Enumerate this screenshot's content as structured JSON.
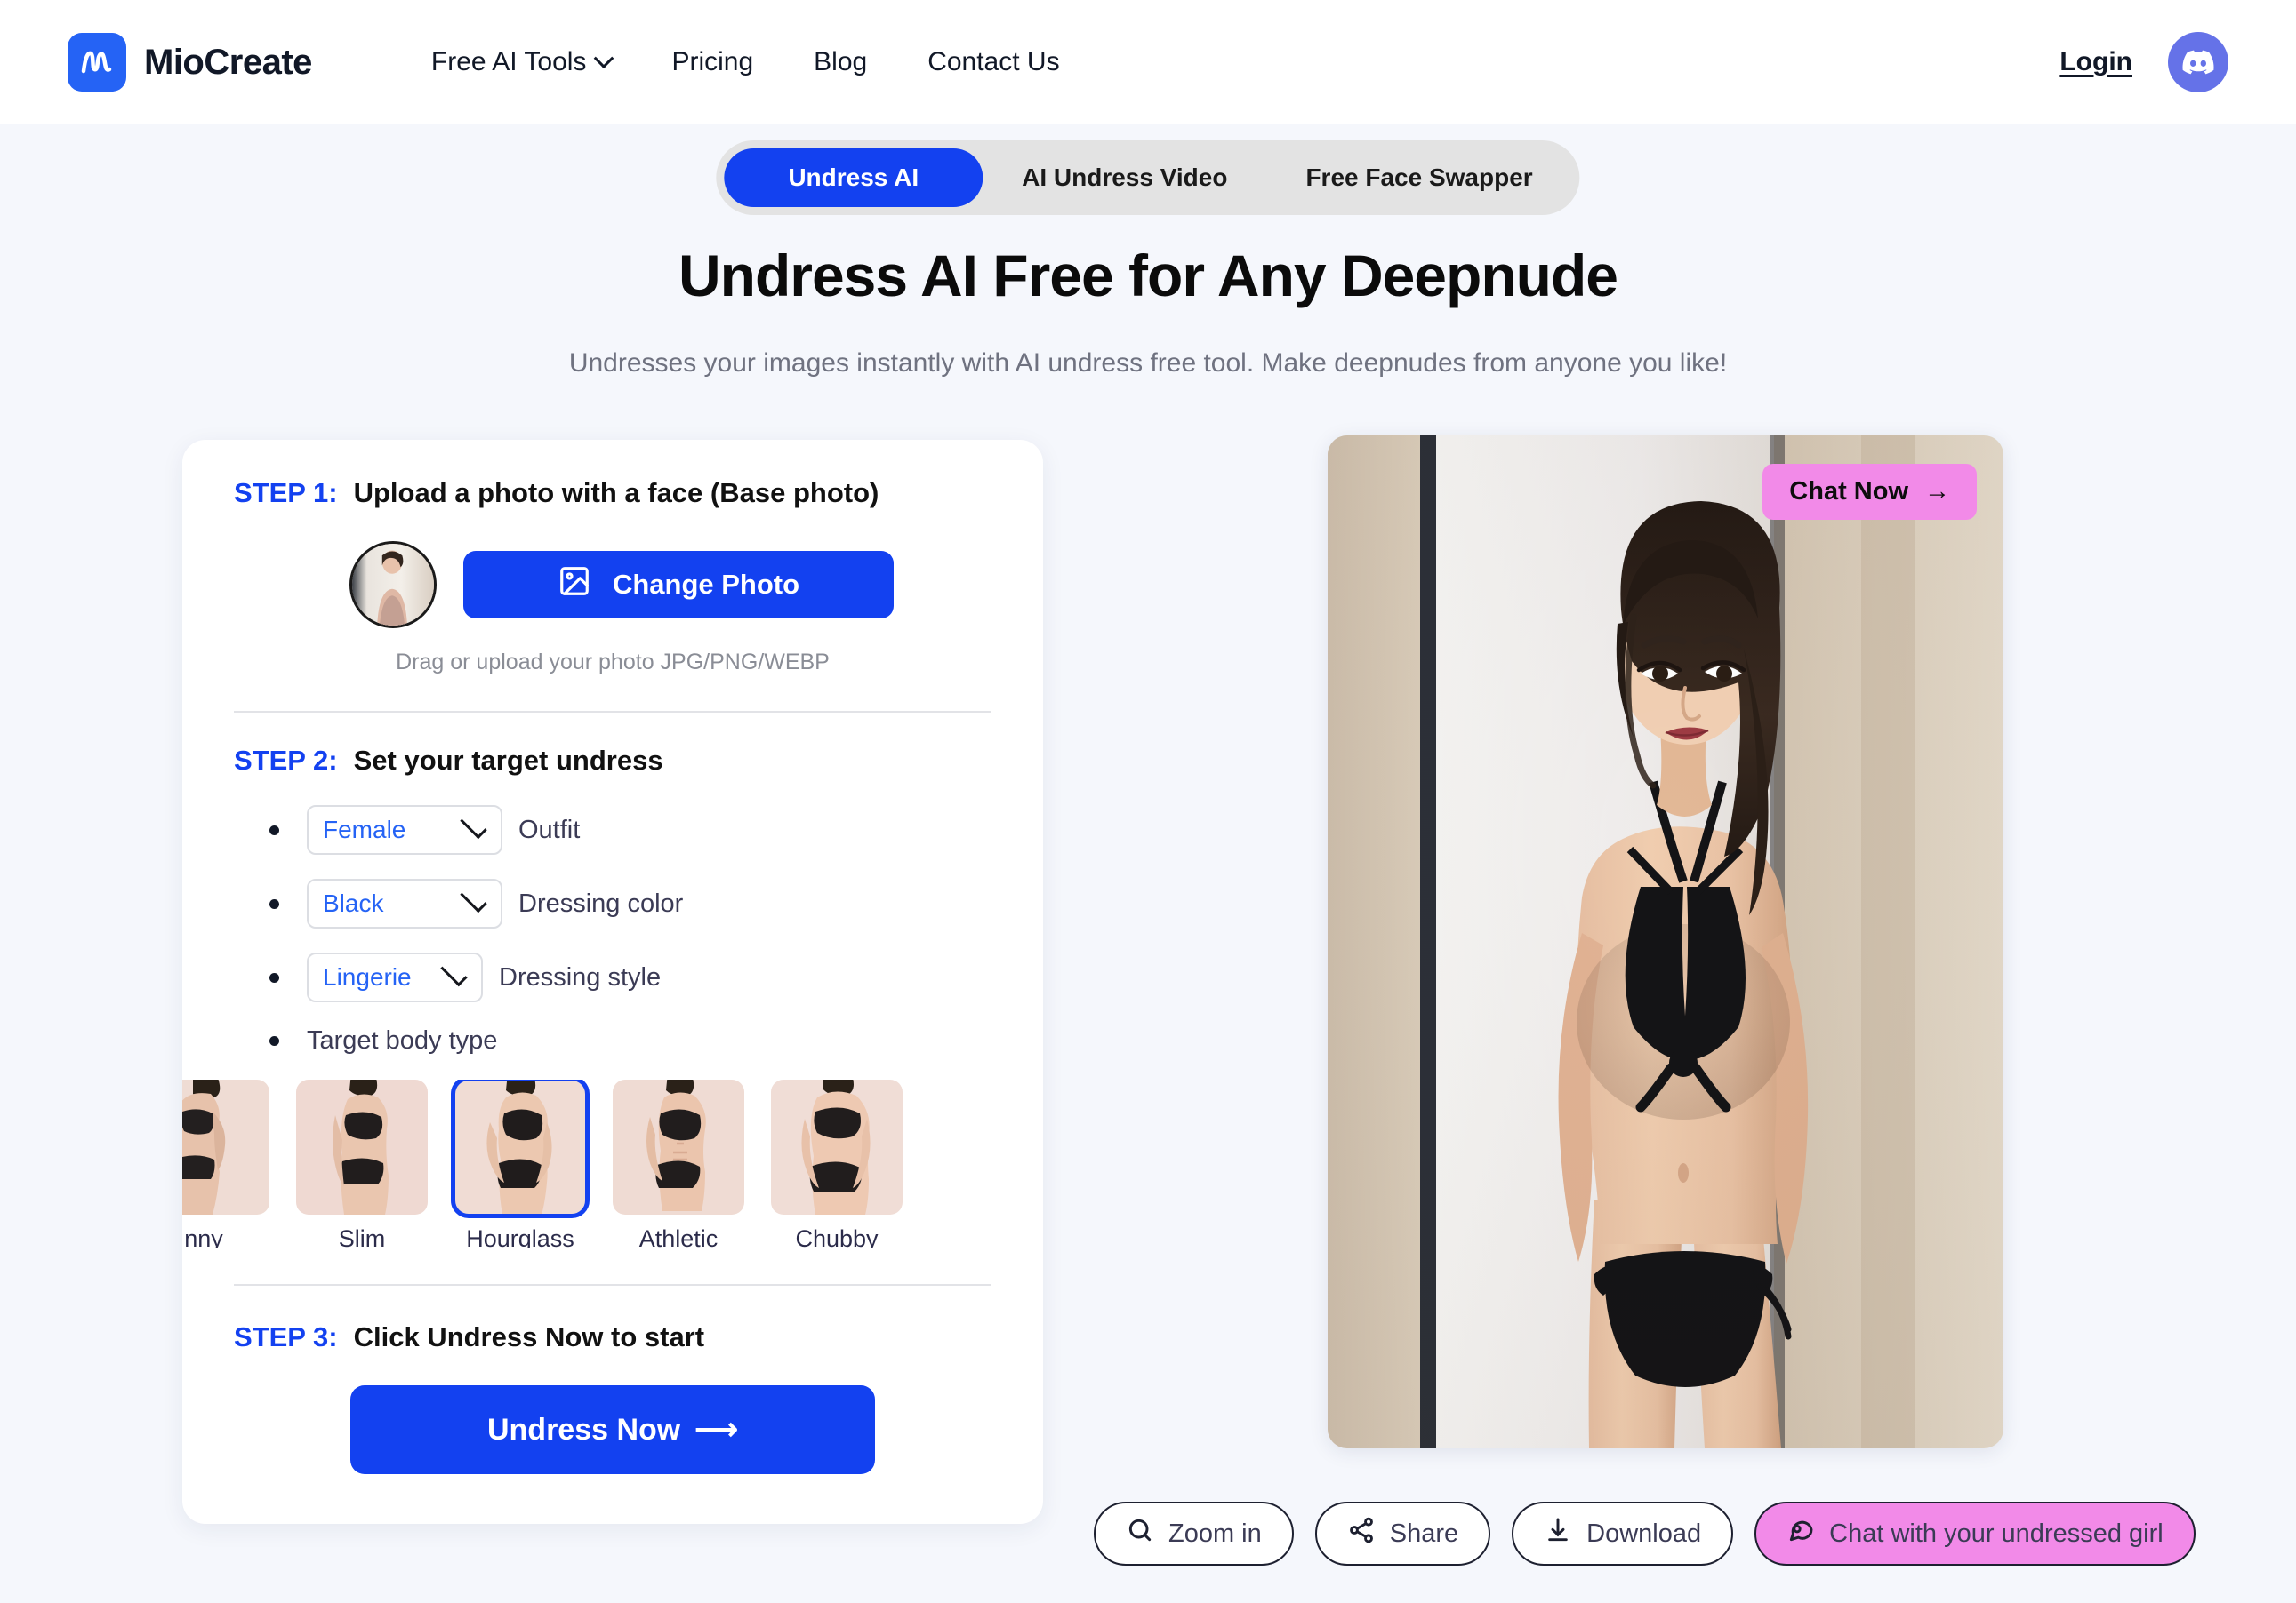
{
  "header": {
    "brand": "MioCreate",
    "nav": [
      {
        "label": "Free AI Tools",
        "has_caret": true
      },
      {
        "label": "Pricing",
        "has_caret": false
      },
      {
        "label": "Blog",
        "has_caret": false
      },
      {
        "label": "Contact Us",
        "has_caret": false
      }
    ],
    "login_label": "Login",
    "discord_icon": "discord-icon"
  },
  "tabs": [
    {
      "label": "Undress AI",
      "active": true
    },
    {
      "label": "AI Undress Video",
      "active": false
    },
    {
      "label": "Free Face Swapper",
      "active": false
    }
  ],
  "hero": {
    "title": "Undress AI Free for Any Deepnude",
    "subtitle": "Undresses your images instantly with AI undress free tool. Make deepnudes from anyone you like!"
  },
  "panel": {
    "step1": {
      "num": "STEP 1:",
      "text": "Upload a photo with a face (Base photo)",
      "change_photo_label": "Change Photo",
      "change_photo_icon": "image-icon",
      "drag_hint": "Drag or upload your photo JPG/PNG/WEBP"
    },
    "step2": {
      "num": "STEP 2:",
      "text": "Set your target undress",
      "options": [
        {
          "value": "Female",
          "label": "Outfit"
        },
        {
          "value": "Black",
          "label": "Dressing color"
        },
        {
          "value": "Lingerie",
          "label": "Dressing style"
        }
      ],
      "body_type_label": "Target body type",
      "body_types": [
        {
          "name": "nny",
          "selected": false
        },
        {
          "name": "Slim",
          "selected": false
        },
        {
          "name": "Hourglass",
          "selected": true
        },
        {
          "name": "Athletic",
          "selected": false
        },
        {
          "name": "Chubby",
          "selected": false
        }
      ]
    },
    "step3": {
      "num": "STEP 3:",
      "text": "Click Undress Now to start",
      "cta_label": "Undress Now",
      "cta_arrow": "⟶"
    }
  },
  "result": {
    "chat_now_label": "Chat Now",
    "chat_now_arrow": "→",
    "actions": [
      {
        "label": "Zoom in",
        "icon": "search-icon",
        "style": "white"
      },
      {
        "label": "Share",
        "icon": "share-icon",
        "style": "white"
      },
      {
        "label": "Download",
        "icon": "download-icon",
        "style": "white"
      },
      {
        "label": "Chat with your undressed girl",
        "icon": "chat-bubble-icon",
        "style": "pink"
      }
    ]
  },
  "colors": {
    "accent_blue": "#1341f0",
    "pink": "#f28ae8",
    "page_bg": "#f5f7fc",
    "tabbar_bg": "#e3e3e3"
  }
}
